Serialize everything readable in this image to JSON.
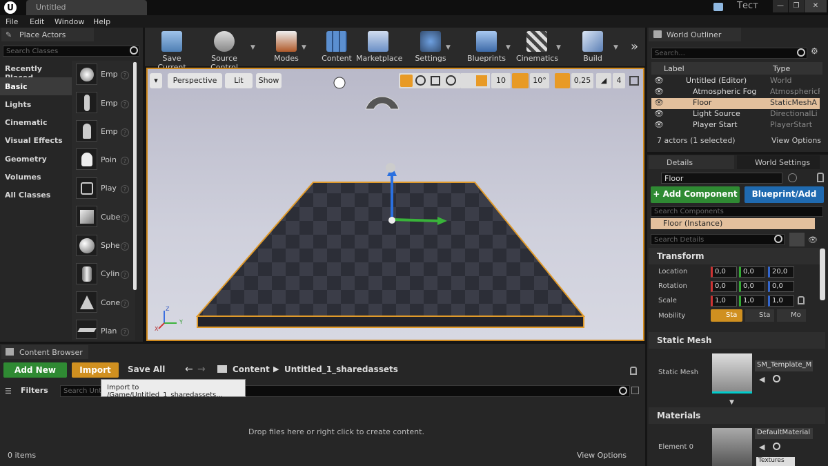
{
  "titlebar": {
    "tab": "Untitled",
    "project": "Тест",
    "min": "—",
    "max": "❐",
    "close": "✕"
  },
  "menu": [
    "File",
    "Edit",
    "Window",
    "Help"
  ],
  "place_actors": {
    "title": "Place Actors",
    "search_placeholder": "Search Classes",
    "categories": [
      "Recently Placed",
      "Basic",
      "Lights",
      "Cinematic",
      "Visual Effects",
      "Geometry",
      "Volumes",
      "All Classes"
    ],
    "items": [
      "Emp",
      "Emp",
      "Emp",
      "Poin",
      "Play",
      "Cube",
      "Sphe",
      "Cylin",
      "Cone",
      "Plan"
    ]
  },
  "toolbar": {
    "buttons": [
      "Save Current",
      "Source Control",
      "Modes",
      "Content",
      "Marketplace",
      "Settings",
      "Blueprints",
      "Cinematics",
      "Build"
    ],
    "more": "»"
  },
  "viewport": {
    "dropdown": "▾",
    "perspective": "Perspective",
    "lit": "Lit",
    "show": "Show",
    "grid": "10",
    "angle": "10°",
    "scale": "0,25",
    "speed": "4",
    "axis_x": "X",
    "axis_y": "Y",
    "axis_z": "Z"
  },
  "outliner": {
    "title": "World Outliner",
    "search_placeholder": "Search...",
    "col_label": "Label",
    "col_type": "Type",
    "rows": [
      {
        "label": "Untitled (Editor)",
        "type": "World"
      },
      {
        "label": "Atmospheric Fog",
        "type": "AtmosphericF"
      },
      {
        "label": "Floor",
        "type": "StaticMeshA"
      },
      {
        "label": "Light Source",
        "type": "DirectionalLi"
      },
      {
        "label": "Player Start",
        "type": "PlayerStart"
      }
    ],
    "count": "7 actors (1 selected)",
    "view_options": "View Options"
  },
  "details": {
    "tab_details": "Details",
    "tab_world": "World Settings",
    "name": "Floor",
    "add_component": "+ Add Component",
    "blueprint": "Blueprint/Add",
    "search_components": "Search Components",
    "instance": "Floor (Instance)",
    "search_details": "Search Details",
    "transform": "Transform",
    "location": "Location",
    "rotation": "Rotation",
    "scale": "Scale",
    "mobility": "Mobility",
    "loc": [
      "0,0",
      "0,0",
      "20,0"
    ],
    "rot": [
      "0,0",
      "0,0",
      "0,0"
    ],
    "scl": [
      "1,0",
      "1,0",
      "1,0"
    ],
    "mob": [
      "Sta",
      "Sta",
      "Mo"
    ],
    "static_mesh_hdr": "Static Mesh",
    "static_mesh_lbl": "Static Mesh",
    "static_mesh_val": "SM_Template_M",
    "materials_hdr": "Materials",
    "element0": "Element 0",
    "material_val": "DefaultMaterial",
    "textures": "Textures"
  },
  "content_browser": {
    "title": "Content Browser",
    "add_new": "Add New",
    "import": "Import",
    "save_all": "Save All",
    "path1": "Content",
    "path2": "Untitled_1_sharedassets",
    "filters": "Filters",
    "search_placeholder": "Search Unt",
    "tooltip": "Import to /Game/Untitled_1_sharedassets...",
    "drop_text": "Drop files here or right click to create content.",
    "items": "0 items",
    "view_options": "View Options"
  }
}
